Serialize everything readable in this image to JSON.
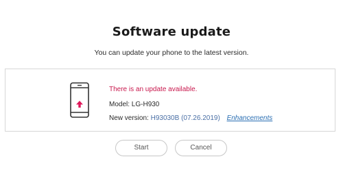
{
  "dialog": {
    "title": "Software update",
    "subtitle": "You can update your phone to the latest version."
  },
  "update_panel": {
    "icon": "phone-update-icon",
    "alert_text": "There is an update available.",
    "model_label": "Model:",
    "model_value": "LG-H930",
    "version_label": "New version:",
    "version_value": "H93030B (07.26.2019)",
    "enhancements_link": "Enhancements"
  },
  "buttons": {
    "start_label": "Start",
    "cancel_label": "Cancel"
  },
  "colors": {
    "alert": "#c8174c",
    "arrow": "#e0175a",
    "link": "#2b6fb3",
    "version": "#4a6fa5",
    "border": "#d6d6d6"
  }
}
